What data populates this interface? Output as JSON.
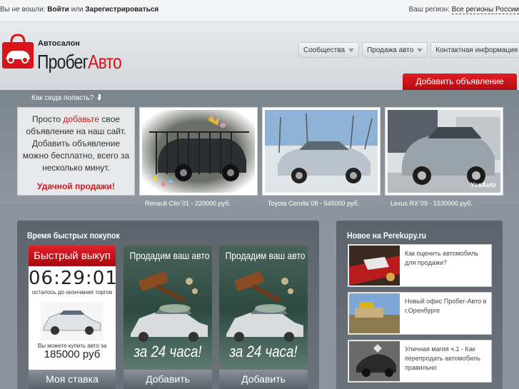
{
  "topbar": {
    "not_logged": "Вы не вошли:",
    "login": "Войти",
    "or": "или",
    "register": "Зарегистрироваться",
    "region_label": "Ваш регион:",
    "region_value": "Все регионы России"
  },
  "logo": {
    "small": "Автосалон",
    "big_black": "Пробег",
    "big_red": "Авто"
  },
  "menu": [
    {
      "label": "Сообщества"
    },
    {
      "label": "Продажа авто"
    },
    {
      "label": "Контактная информация"
    }
  ],
  "add_ad_button": "Добавить объявление",
  "howto": "Как сюда попасть?",
  "promo": {
    "line1_pre": "Просто ",
    "line1_red": "добавьте",
    "line1_post": " свое объявление на наш сайт. Добавить объявление можно бесплатно, всего за несколько минут.",
    "good_luck": "Удачной продажи!"
  },
  "cars": [
    {
      "caption": "Renault Clio`01 - 220000 руб."
    },
    {
      "caption": "Toyota Corolla`08 - 545000 руб."
    },
    {
      "caption": "Lexus RX`09 - 1530000 руб.",
      "watermark": "YesAuto"
    }
  ],
  "fast": {
    "section_title": "Время быстрых покупок",
    "header": "Быстрый выкуп",
    "timer": "06:29:01",
    "timer_note": "осталось до окончания торгов",
    "buy_note": "Вы можете купить авто за",
    "price": "185000 руб",
    "bid_button": "Моя ставка"
  },
  "sell_banners": [
    {
      "title": "Продадим ваш авто",
      "deadline": "за 24 часа!",
      "button": "Добавить"
    },
    {
      "title": "Продадим ваш авто",
      "deadline": "за 24 часа!",
      "button": "Добавить"
    }
  ],
  "news": {
    "section_title": "Новое на Perekupy.ru",
    "items": [
      {
        "text": "Как оценить автомобиль для продажи?"
      },
      {
        "text": "Новый офис Пробег-Авто в г.Оренбурге"
      },
      {
        "text": "Уличная магия ч.1 - Как перепродать автомобиль правильно"
      }
    ]
  },
  "colors": {
    "brand_red": "#d8141a",
    "band": "#8a9199",
    "panel": "#62696f"
  }
}
